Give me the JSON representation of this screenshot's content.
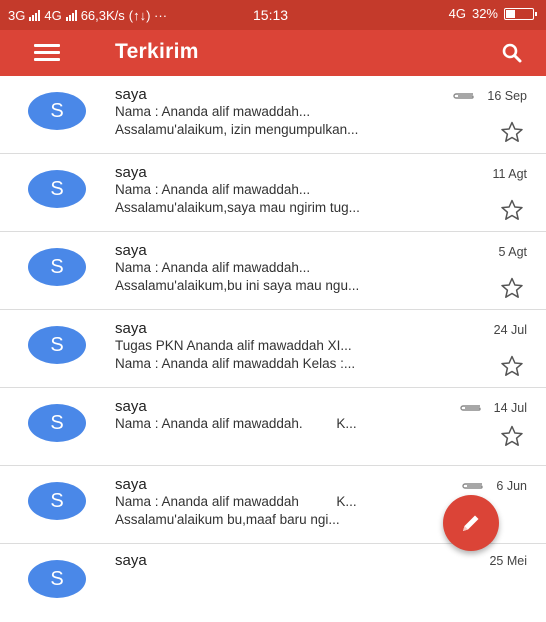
{
  "status_bar": {
    "network_1": "3G",
    "network_2": "4G",
    "speed": "66,3K/s",
    "extra": "(↑↓) ···",
    "time": "15:13",
    "network_3": "4G",
    "battery": "32%",
    "battery_level": 0.32
  },
  "app_bar": {
    "title": "Terkirim",
    "menu_icon": "menu-icon",
    "search_icon": "search-icon"
  },
  "emails": [
    {
      "sender": "saya",
      "date": "16 Sep",
      "attachment": true,
      "subject": "Nama : Ananda alif mawaddah...",
      "snippet": "Assalamu'alaikum, izin mengumpulkan..."
    },
    {
      "sender": "saya",
      "date": "11 Agt",
      "attachment": false,
      "subject": "Nama : Ananda alif mawaddah...",
      "snippet": "Assalamu'alaikum,saya mau ngirim tug..."
    },
    {
      "sender": "saya",
      "date": "5 Agt",
      "attachment": false,
      "subject": "Nama : Ananda alif mawaddah...",
      "snippet": "Assalamu'alaikum,bu ini saya mau ngu..."
    },
    {
      "sender": "saya",
      "date": "24 Jul",
      "attachment": false,
      "subject": "Tugas PKN Ananda alif mawaddah XI...",
      "snippet": "Nama : Ananda alif mawaddah Kelas :..."
    },
    {
      "sender": "saya",
      "date": "14 Jul",
      "attachment": true,
      "subject": "Nama : Ananda alif mawaddah.         K...",
      "snippet": ""
    },
    {
      "sender": "saya",
      "date": "6 Jun",
      "attachment": true,
      "subject": "Nama : Ananda alif mawaddah          K...",
      "snippet": "Assalamu'alaikum bu,maaf baru ngi..."
    },
    {
      "sender": "saya",
      "date": "25 Mei",
      "attachment": false,
      "subject": "",
      "snippet": ""
    }
  ],
  "avatar_letter": "S",
  "colors": {
    "primary": "#db4437",
    "status_bar": "#c43a2b",
    "avatar": "#4a88e8"
  }
}
